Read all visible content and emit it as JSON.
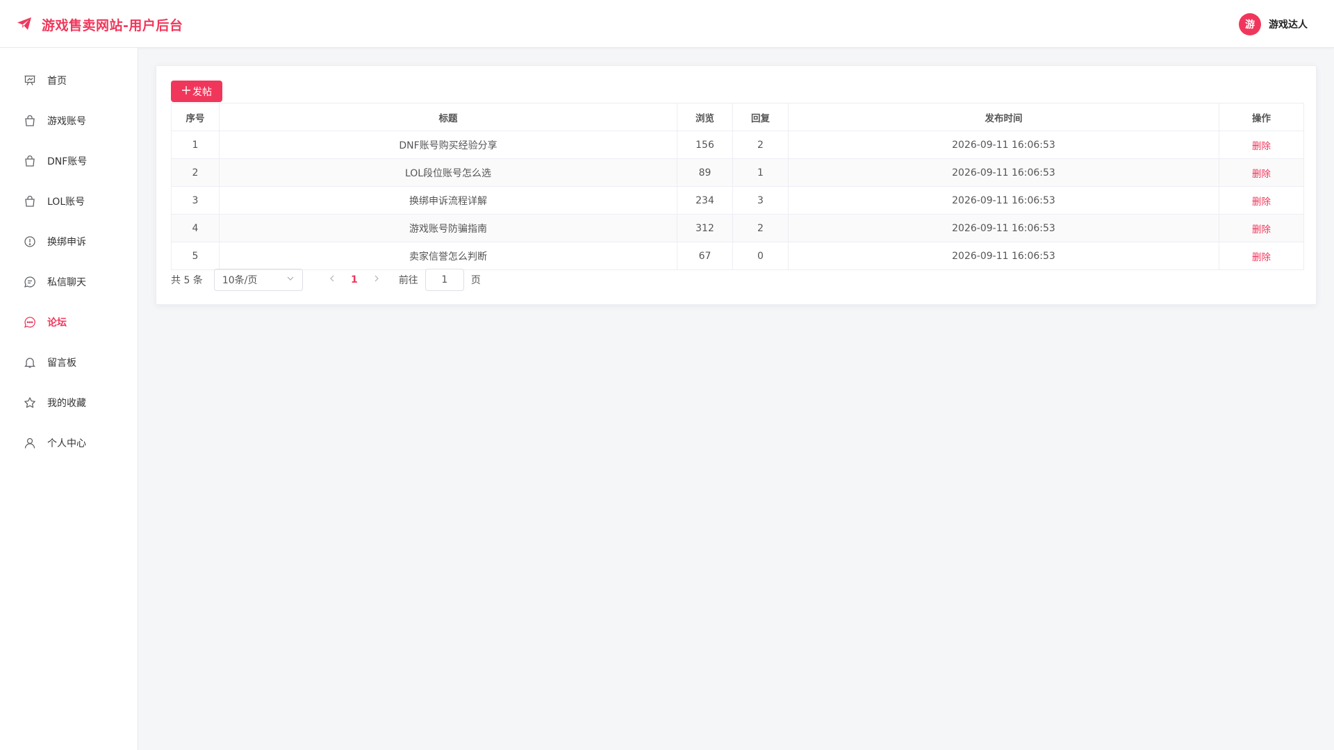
{
  "header": {
    "brand_title": "游戏售卖网站-用户后台",
    "user_avatar_char": "游",
    "user_name": "游戏达人"
  },
  "sidebar": {
    "items": [
      {
        "label": "首页",
        "icon": "presentation-icon"
      },
      {
        "label": "游戏账号",
        "icon": "shopping-bag-icon"
      },
      {
        "label": "DNF账号",
        "icon": "shopping-bag-icon"
      },
      {
        "label": "LOL账号",
        "icon": "shopping-bag-icon"
      },
      {
        "label": "换绑申诉",
        "icon": "warning-circle-icon"
      },
      {
        "label": "私信聊天",
        "icon": "chat-bubble-icon"
      },
      {
        "label": "论坛",
        "icon": "chat-dots-icon",
        "active": true
      },
      {
        "label": "留言板",
        "icon": "bell-icon"
      },
      {
        "label": "我的收藏",
        "icon": "star-icon"
      },
      {
        "label": "个人中心",
        "icon": "user-icon"
      }
    ]
  },
  "toolbar": {
    "post_button": "发帖"
  },
  "table": {
    "columns": [
      "序号",
      "标题",
      "浏览",
      "回复",
      "发布时间",
      "操作"
    ],
    "rows": [
      {
        "index": "1",
        "title": "DNF账号购买经验分享",
        "views": "156",
        "replies": "2",
        "time": "2026-09-11 16:06:53",
        "action": "删除"
      },
      {
        "index": "2",
        "title": "LOL段位账号怎么选",
        "views": "89",
        "replies": "1",
        "time": "2026-09-11 16:06:53",
        "action": "删除"
      },
      {
        "index": "3",
        "title": "换绑申诉流程详解",
        "views": "234",
        "replies": "3",
        "time": "2026-09-11 16:06:53",
        "action": "删除"
      },
      {
        "index": "4",
        "title": "游戏账号防骗指南",
        "views": "312",
        "replies": "2",
        "time": "2026-09-11 16:06:53",
        "action": "删除"
      },
      {
        "index": "5",
        "title": "卖家信誉怎么判断",
        "views": "67",
        "replies": "0",
        "time": "2026-09-11 16:06:53",
        "action": "删除"
      }
    ]
  },
  "pagination": {
    "total_text": "共 5 条",
    "page_size": "10条/页",
    "current_page": "1",
    "goto_label": "前往",
    "goto_value": "1",
    "page_suffix": "页"
  },
  "colors": {
    "accent": "#f0375b"
  }
}
